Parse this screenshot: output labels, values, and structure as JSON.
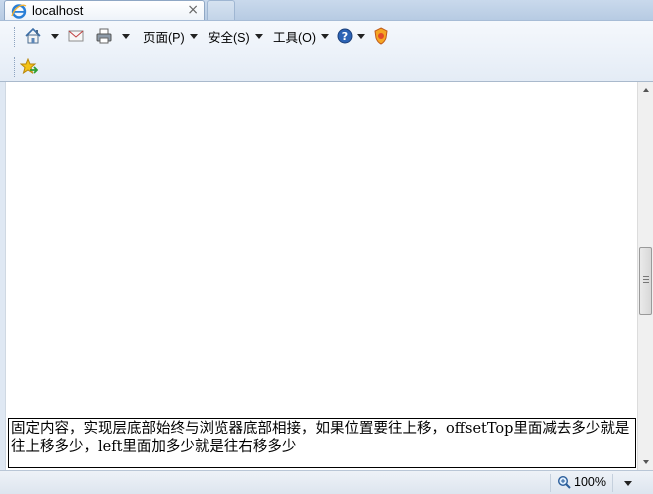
{
  "tab": {
    "title": "localhost",
    "close": "×"
  },
  "toolbar": {
    "page_label": "页面(P)",
    "safety_label": "安全(S)",
    "tools_label": "工具(O)"
  },
  "content": {
    "fixed_text": "固定内容，实现层底部始终与浏览器底部相接，如果位置要往上移，offsetTop里面减去多少就是往上移多少，left里面加多少就是往右移多少"
  },
  "status": {
    "zoom_label": "100%"
  },
  "colors": {
    "accent": "#1f5fb8",
    "toolbar_bg": "#e4ecf6",
    "page_bg": "#ffffff"
  }
}
